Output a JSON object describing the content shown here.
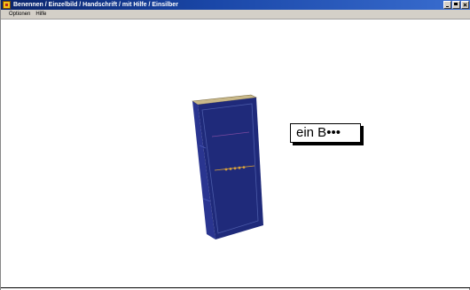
{
  "window": {
    "title": "Benennen / Einzelbild / Handschrift / mit Hilfe / Einsilber"
  },
  "menu": {
    "items": [
      "Optionen",
      "Hilfe"
    ]
  },
  "word_card": {
    "text": "ein B•••"
  },
  "picture": {
    "subject": "book-icon",
    "colors": {
      "cover": "#1f2a7a",
      "spine": "#2a3590",
      "pages": "#c9b98a",
      "trim": "#d8a13a"
    }
  }
}
